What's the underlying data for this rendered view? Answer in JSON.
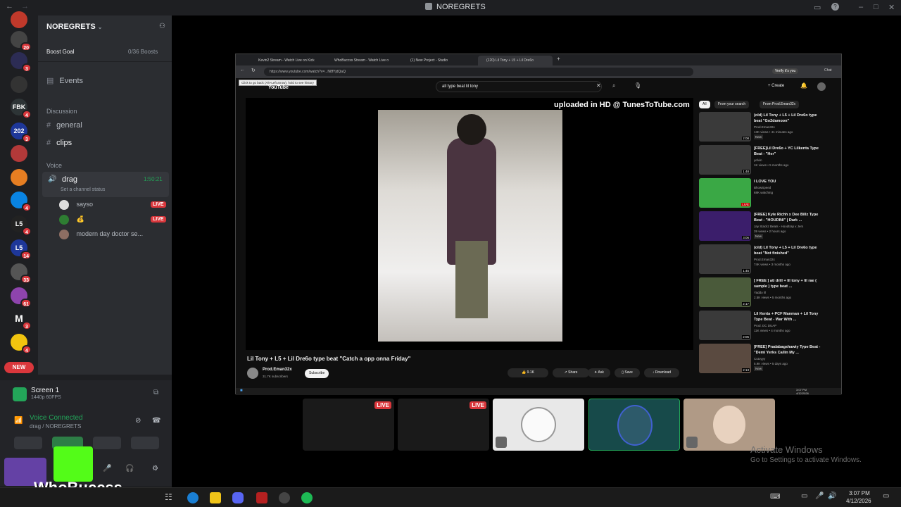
{
  "app": {
    "window_title": "NOREGRETS"
  },
  "server": {
    "name": "NOREGRETS",
    "boost_label": "Boost Goal",
    "boost_count": "0/36 Boosts"
  },
  "rail": {
    "badges": [
      "20",
      "3",
      "4",
      "3",
      "4",
      "4",
      "14",
      "33",
      "61",
      "3",
      "4"
    ],
    "labels": [
      "",
      "",
      "",
      "FBK",
      "202",
      "",
      "",
      "",
      "L5",
      "L5",
      "",
      "",
      "M",
      ""
    ],
    "new_label": "NEW"
  },
  "channels": {
    "events": "Events",
    "cat_discussion": "Discussion",
    "general": "general",
    "clips": "clips",
    "cat_voice": "Voice",
    "voice_channel": "drag",
    "voice_timer": "1:50:21",
    "status_hint": "Set a channel status",
    "members": [
      {
        "name": "sayso",
        "badge": "LIVE"
      },
      {
        "name": "💰",
        "badge": "LIVE"
      },
      {
        "name": "modern day doctor se..."
      }
    ]
  },
  "panel": {
    "screen_title": "Screen 1",
    "screen_sub": "1440p 60FPS",
    "voice_status": "Voice Connected",
    "voice_location": "drag / NOREGRETS",
    "overlay_name": "WhoBuccss"
  },
  "browser": {
    "tabs": [
      "Kevin2 Stream - Watch Live on Kick",
      "WhoBuccss Stream - Watch Live o",
      "(1) New Project - Studio",
      "(120) Lil Tony + L5 + Lil Dre6o"
    ],
    "url": "https://www.youtube.com/watch?v=...N8fYjdQaQ",
    "tooltip": "Click to go back (Alt+Left arrow), hold to see history",
    "verify_label": "Verify it's you",
    "chat_label": "Chat"
  },
  "youtube": {
    "logo": "YouTube",
    "search_value": "all type beat lil tony",
    "create_label": "Create",
    "watermark": "uploaded in HD @ TunesToTube.com",
    "video_title": "Lil Tony + L5 + Lil Dre6o type beat \"Catch a opp onna Friday\"",
    "channel": "Prod.Eman32x",
    "subs": "31.7K subscribers",
    "subscribe": "Subscribe",
    "likes": "9.1K",
    "share": "Share",
    "ask": "Ask",
    "save": "Save",
    "download": "Download",
    "filters": [
      "All",
      "From your search",
      "From Prod.Eman32x"
    ],
    "recs": [
      {
        "title": "(old) Lil Tony + L5 + Lil Dre6o type beat \"Go2damoon\"",
        "channel": "Prod.Eman32x",
        "meta": "13K views • 41 minutes ago",
        "tag": "New",
        "duration": "2:08"
      },
      {
        "title": "[FREE]Lil Dre6o + YC Lilkenta Type Beat - \"Her\"",
        "channel": "yelvin",
        "meta": "1K views • 5 months ago",
        "tag": "",
        "duration": "1:48"
      },
      {
        "title": "I LOVE YOU",
        "channel": "BhowSpeed",
        "meta": "68K watching",
        "tag": "",
        "duration": "LIVE"
      },
      {
        "title": "[FREE] Kyle Richh x Dee Billz Type Beat - \"HOUDINI\" | Dark ...",
        "channel": "Jay Stackz Beats - Hoodtrap x Jers",
        "meta": "39 views • 2 hours ago",
        "tag": "New",
        "duration": "3:06"
      },
      {
        "title": "(old) Lil Tony + L5 + Lil Dre6o type beat \"Not finished\"",
        "channel": "Prod.Eman32x",
        "meta": "74K views • 3 months ago",
        "tag": "",
        "duration": "1:45"
      },
      {
        "title": "[ FREE ] ati drill + lil tony + lil rae ( sample ) type beat ...",
        "channel": "Yaddo lil",
        "meta": "2.5K views • 5 months ago",
        "tag": "",
        "duration": "2:17"
      },
      {
        "title": "Lil Kenta + PCF Manman + Lil Tony Type Beat - War With ...",
        "channel": "Prod. DC DUAP",
        "meta": "11K views • 4 months ago",
        "tag": "",
        "duration": "2:05"
      },
      {
        "title": "[FREE] Pradabagshawty Type Beat - \"Demi Yerks Callin My ...",
        "channel": "Cutoyyy",
        "meta": "5.9K views • 5 days ago",
        "tag": "New",
        "duration": "2:13"
      }
    ],
    "taskbar_time": "3:07 PM",
    "taskbar_date": "4/12/2026"
  },
  "tiles": {
    "live1": "LIVE",
    "live2": "LIVE"
  },
  "activate": {
    "title": "Activate Windows",
    "sub": "Go to Settings to activate Windows."
  },
  "taskbar": {
    "time": "3:07 PM",
    "date": "4/12/2026"
  }
}
